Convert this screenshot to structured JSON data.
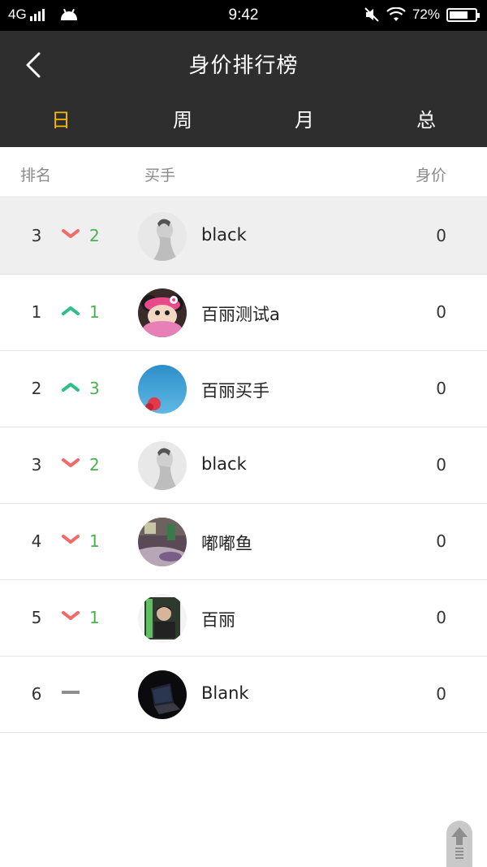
{
  "status_bar": {
    "network": "4G",
    "time": "9:42",
    "battery": "72%",
    "battery_level": 0.72
  },
  "header": {
    "title": "身价排行榜",
    "tabs": [
      {
        "label": "日",
        "active": true
      },
      {
        "label": "周",
        "active": false
      },
      {
        "label": "月",
        "active": false
      },
      {
        "label": "总",
        "active": false
      }
    ]
  },
  "columns": {
    "rank": "排名",
    "buyer": "买手",
    "value": "身价"
  },
  "colors": {
    "accent": "#f5b800",
    "up": "#2bbf8a",
    "down": "#f06a6a",
    "delta_text": "#4caf50"
  },
  "rows": [
    {
      "rank": "3",
      "trend": "down",
      "delta": "2",
      "name": "black",
      "value": "0",
      "avatar": "portrait-avatar",
      "highlight": true
    },
    {
      "rank": "1",
      "trend": "up",
      "delta": "1",
      "name": "百丽测试a",
      "value": "0",
      "avatar": "cartoon-mouse-avatar",
      "highlight": false
    },
    {
      "rank": "2",
      "trend": "up",
      "delta": "3",
      "name": "百丽买手",
      "value": "0",
      "avatar": "sky-flower-avatar",
      "highlight": false
    },
    {
      "rank": "3",
      "trend": "down",
      "delta": "2",
      "name": "black",
      "value": "0",
      "avatar": "portrait-avatar",
      "highlight": false
    },
    {
      "rank": "4",
      "trend": "down",
      "delta": "1",
      "name": "嘟嘟鱼",
      "value": "0",
      "avatar": "room-photo-avatar",
      "highlight": false
    },
    {
      "rank": "5",
      "trend": "down",
      "delta": "1",
      "name": "百丽",
      "value": "0",
      "avatar": "person-photo-avatar",
      "highlight": false
    },
    {
      "rank": "6",
      "trend": "none",
      "delta": "",
      "name": "Blank",
      "value": "0",
      "avatar": "laptop-dark-avatar",
      "highlight": false
    }
  ]
}
